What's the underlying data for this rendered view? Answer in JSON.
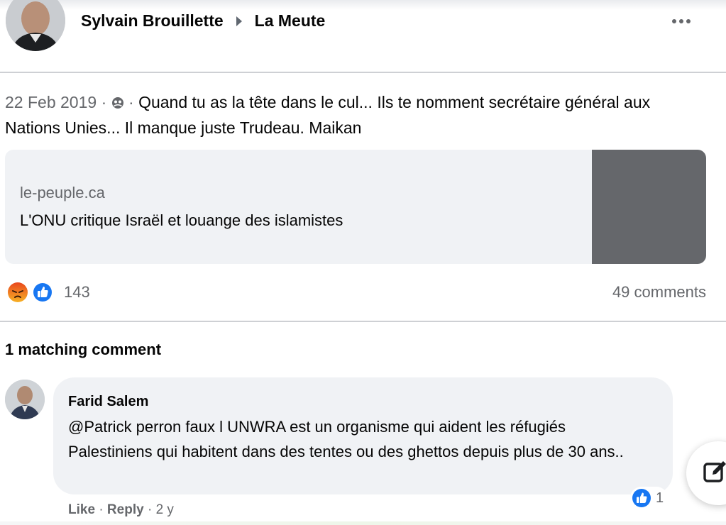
{
  "post": {
    "author": "Sylvain Brouillette",
    "group": "La Meute",
    "date": "22 Feb 2019",
    "separator": "·",
    "text": "Quand tu as la tête dans le cul... Ils te nomment secrétaire général aux Nations Unies... Il manque juste Trudeau. Maikan",
    "privacy_icon": "group-icon",
    "more_icon": "more-options-icon"
  },
  "link_preview": {
    "domain": "le-peuple.ca",
    "headline": "L'ONU critique Israël et louange des islamistes"
  },
  "reactions": {
    "icons": [
      "angry-reaction-icon",
      "like-reaction-icon"
    ],
    "count": "143",
    "comments_label": "49 comments"
  },
  "matching": {
    "title": "1 matching comment"
  },
  "comment": {
    "author": "Farid Salem",
    "text": "@Patrick perron faux l UNWRA est un organisme qui aident les réfugiés Palestiniens qui habitent dans des tentes ou des ghettos depuis plus de 30 ans..",
    "like_count": "1",
    "actions": {
      "like": "Like",
      "reply": "Reply",
      "separator": "·",
      "age": "2 y"
    }
  },
  "colors": {
    "secondary_text": "#65676b",
    "card_bg": "#f0f2f5",
    "like_blue": "#1877f2",
    "angry_orange": "#f25c2a"
  }
}
